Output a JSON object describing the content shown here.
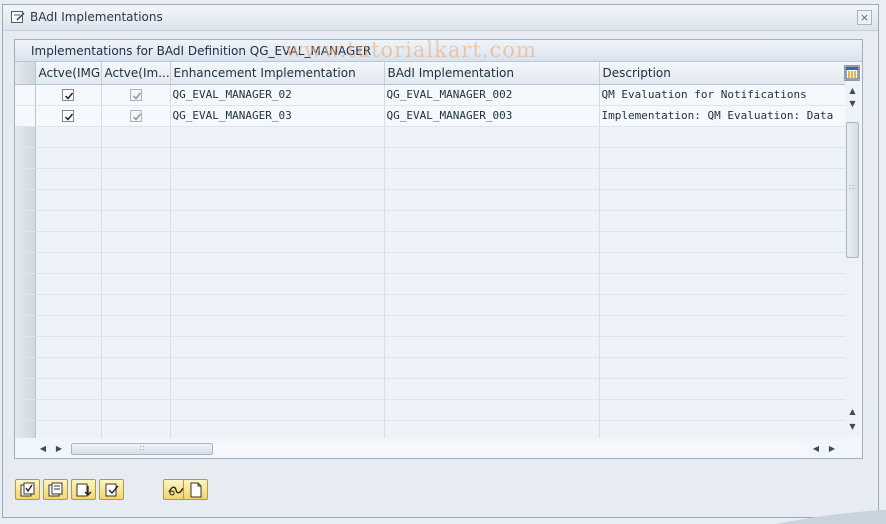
{
  "window": {
    "title": "BAdI Implementations",
    "close_label": "×"
  },
  "grid": {
    "title": "Implementations for BAdI Definition QG_EVAL_MANAGER",
    "watermark": "www.tutorialkart.com",
    "columns": [
      "Actve(IMG)",
      "Actve(Im...",
      "Enhancement Implementation",
      "BAdI Implementation",
      "Description"
    ],
    "rows": [
      {
        "active_img": true,
        "active_impl": true,
        "enhancement_impl": "QG_EVAL_MANAGER_02",
        "badi_impl": "QG_EVAL_MANAGER_002",
        "description": "QM Evaluation for Notifications"
      },
      {
        "active_img": true,
        "active_impl": true,
        "enhancement_impl": "QG_EVAL_MANAGER_03",
        "badi_impl": "QG_EVAL_MANAGER_003",
        "description": "Implementation: QM Evaluation: Data"
      }
    ],
    "empty_rows": 15
  },
  "scrollbars": {
    "up_arrow": "▲",
    "down_arrow": "▼",
    "left_arrow": "◀",
    "right_arrow": "▶",
    "grip": "∷"
  },
  "toolbar": {
    "buttons": [
      "select-all-icon",
      "deselect-all-icon",
      "sort-icon",
      "filter-icon",
      "display-icon",
      "new-document-icon"
    ]
  },
  "colors": {
    "accent": "#f2d568",
    "header": "#e2e9f0",
    "row": "#f5f9fd"
  }
}
